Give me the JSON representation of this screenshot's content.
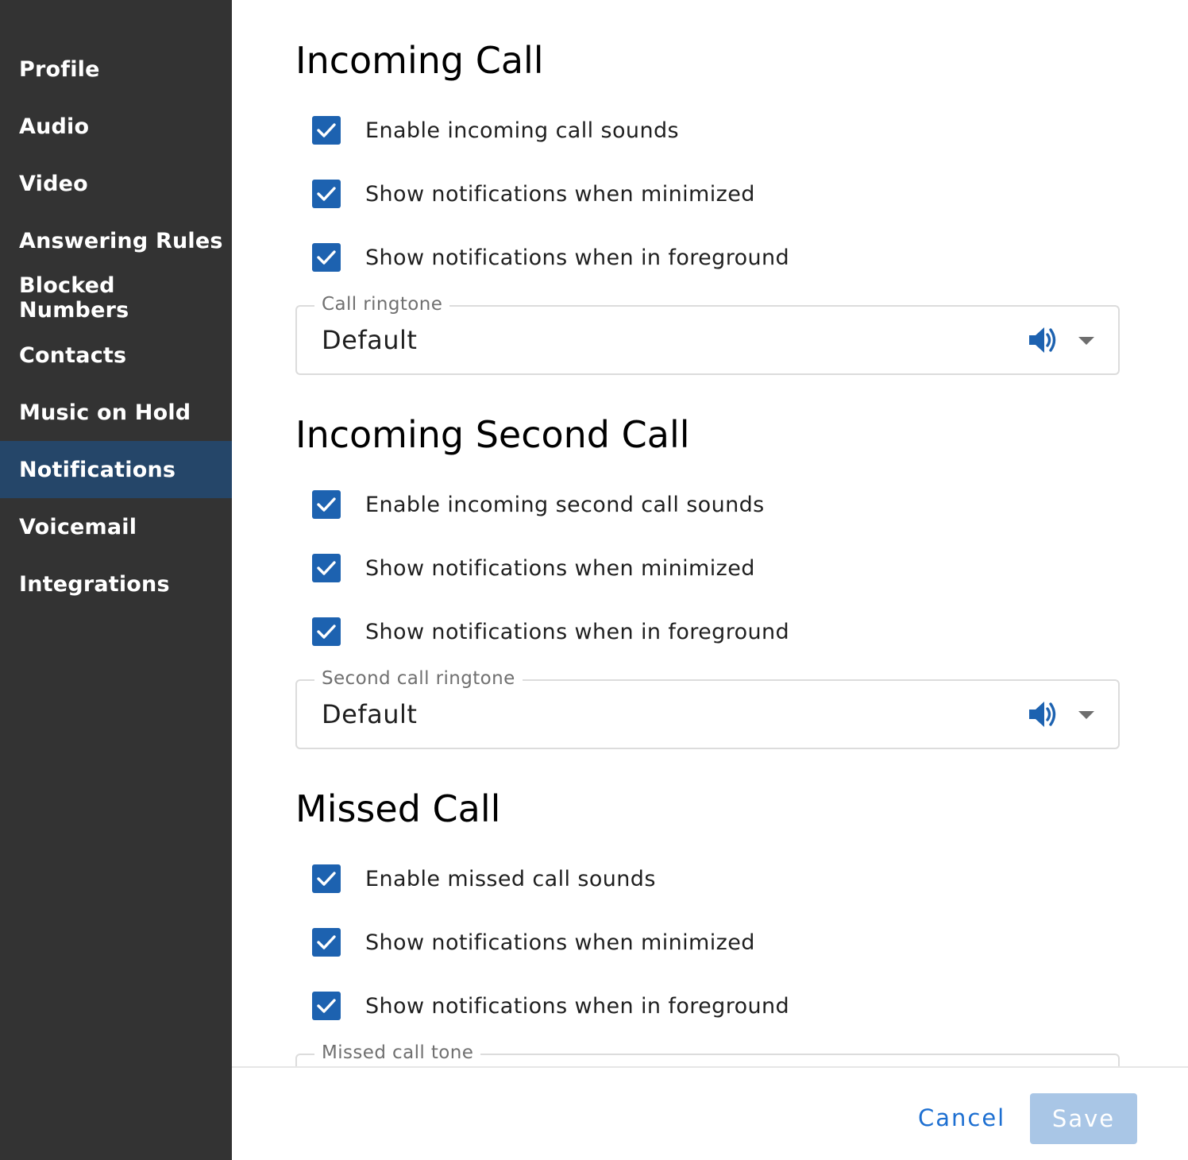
{
  "colors": {
    "sidebar_bg": "#333333",
    "sidebar_active_bg": "#254669",
    "checkbox_accent": "#1d62b0",
    "speaker_icon": "#1d62b0",
    "link": "#1d6fd1",
    "save_disabled": "#a9c6e6"
  },
  "sidebar": {
    "active": "Notifications",
    "items": [
      {
        "label": "Profile"
      },
      {
        "label": "Audio"
      },
      {
        "label": "Video"
      },
      {
        "label": "Answering Rules"
      },
      {
        "label": "Blocked Numbers"
      },
      {
        "label": "Contacts"
      },
      {
        "label": "Music on Hold"
      },
      {
        "label": "Notifications"
      },
      {
        "label": "Voicemail"
      },
      {
        "label": "Integrations"
      }
    ]
  },
  "sections": [
    {
      "title": "Incoming Call",
      "options": [
        {
          "label": "Enable incoming call sounds",
          "checked": true
        },
        {
          "label": "Show notifications when minimized",
          "checked": true
        },
        {
          "label": "Show notifications when in foreground",
          "checked": true
        }
      ],
      "select": {
        "legend": "Call ringtone",
        "value": "Default",
        "icon": "speaker-icon"
      }
    },
    {
      "title": "Incoming Second Call",
      "options": [
        {
          "label": "Enable incoming second call sounds",
          "checked": true
        },
        {
          "label": "Show notifications when minimized",
          "checked": true
        },
        {
          "label": "Show notifications when in foreground",
          "checked": true
        }
      ],
      "select": {
        "legend": "Second call ringtone",
        "value": "Default",
        "icon": "speaker-icon"
      }
    },
    {
      "title": "Missed Call",
      "options": [
        {
          "label": "Enable missed call sounds",
          "checked": true
        },
        {
          "label": "Show notifications when minimized",
          "checked": true
        },
        {
          "label": "Show notifications when in foreground",
          "checked": true
        }
      ],
      "select": {
        "legend": "Missed call tone"
      }
    }
  ],
  "footer": {
    "cancel_label": "Cancel",
    "save_label": "Save",
    "save_enabled": false
  }
}
